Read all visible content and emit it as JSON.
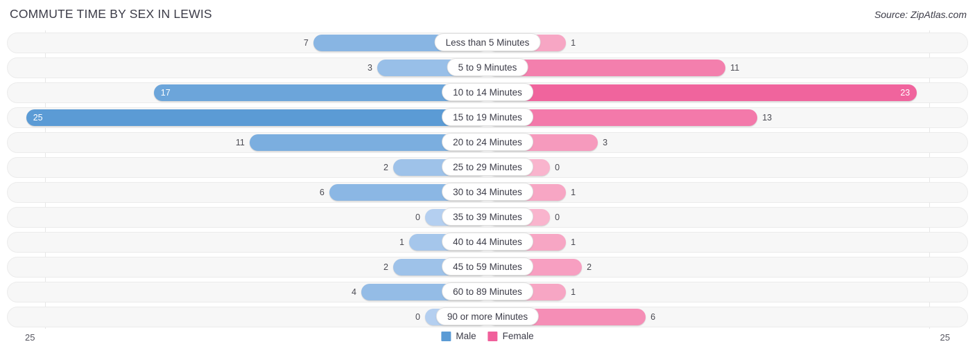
{
  "header": {
    "title": "COMMUTE TIME BY SEX IN LEWIS",
    "source": "Source: ZipAtlas.com"
  },
  "axis": {
    "left_tick": "25",
    "right_tick": "25",
    "max": 25
  },
  "legend": {
    "items": [
      {
        "label": "Male",
        "color": "#5b9bd5"
      },
      {
        "label": "Female",
        "color": "#f0609b"
      }
    ]
  },
  "colors": {
    "male_max": "#5b9bd5",
    "male_min": "#b4cff0",
    "female_max": "#f0609b",
    "female_min": "#f9b4cd",
    "track": "#f7f7f7",
    "track_border": "#ebebeb",
    "text": "#3c3c48"
  },
  "chart_data": {
    "type": "bar",
    "title": "COMMUTE TIME BY SEX IN LEWIS",
    "subtitle": "Source: ZipAtlas.com",
    "orientation": "horizontal-diverging",
    "xlabel": "",
    "ylabel": "",
    "xlim": [
      25,
      25
    ],
    "grid": false,
    "legend_position": "bottom-center",
    "categories": [
      "Less than 5 Minutes",
      "5 to 9 Minutes",
      "10 to 14 Minutes",
      "15 to 19 Minutes",
      "20 to 24 Minutes",
      "25 to 29 Minutes",
      "30 to 34 Minutes",
      "35 to 39 Minutes",
      "40 to 44 Minutes",
      "45 to 59 Minutes",
      "60 to 89 Minutes",
      "90 or more Minutes"
    ],
    "series": [
      {
        "name": "Male",
        "side": "left",
        "values": [
          7,
          3,
          17,
          25,
          11,
          2,
          6,
          0,
          1,
          2,
          4,
          0
        ]
      },
      {
        "name": "Female",
        "side": "right",
        "values": [
          1,
          11,
          23,
          13,
          3,
          0,
          1,
          0,
          1,
          2,
          1,
          6
        ]
      }
    ]
  },
  "rows": [
    {
      "label": "Less than 5 Minutes",
      "male": "7",
      "female": "1"
    },
    {
      "label": "5 to 9 Minutes",
      "male": "3",
      "female": "11"
    },
    {
      "label": "10 to 14 Minutes",
      "male": "17",
      "female": "23"
    },
    {
      "label": "15 to 19 Minutes",
      "male": "25",
      "female": "13"
    },
    {
      "label": "20 to 24 Minutes",
      "male": "11",
      "female": "3"
    },
    {
      "label": "25 to 29 Minutes",
      "male": "2",
      "female": "0"
    },
    {
      "label": "30 to 34 Minutes",
      "male": "6",
      "female": "1"
    },
    {
      "label": "35 to 39 Minutes",
      "male": "0",
      "female": "0"
    },
    {
      "label": "40 to 44 Minutes",
      "male": "1",
      "female": "1"
    },
    {
      "label": "45 to 59 Minutes",
      "male": "2",
      "female": "2"
    },
    {
      "label": "60 to 89 Minutes",
      "male": "4",
      "female": "1"
    },
    {
      "label": "90 or more Minutes",
      "male": "0",
      "female": "6"
    }
  ]
}
